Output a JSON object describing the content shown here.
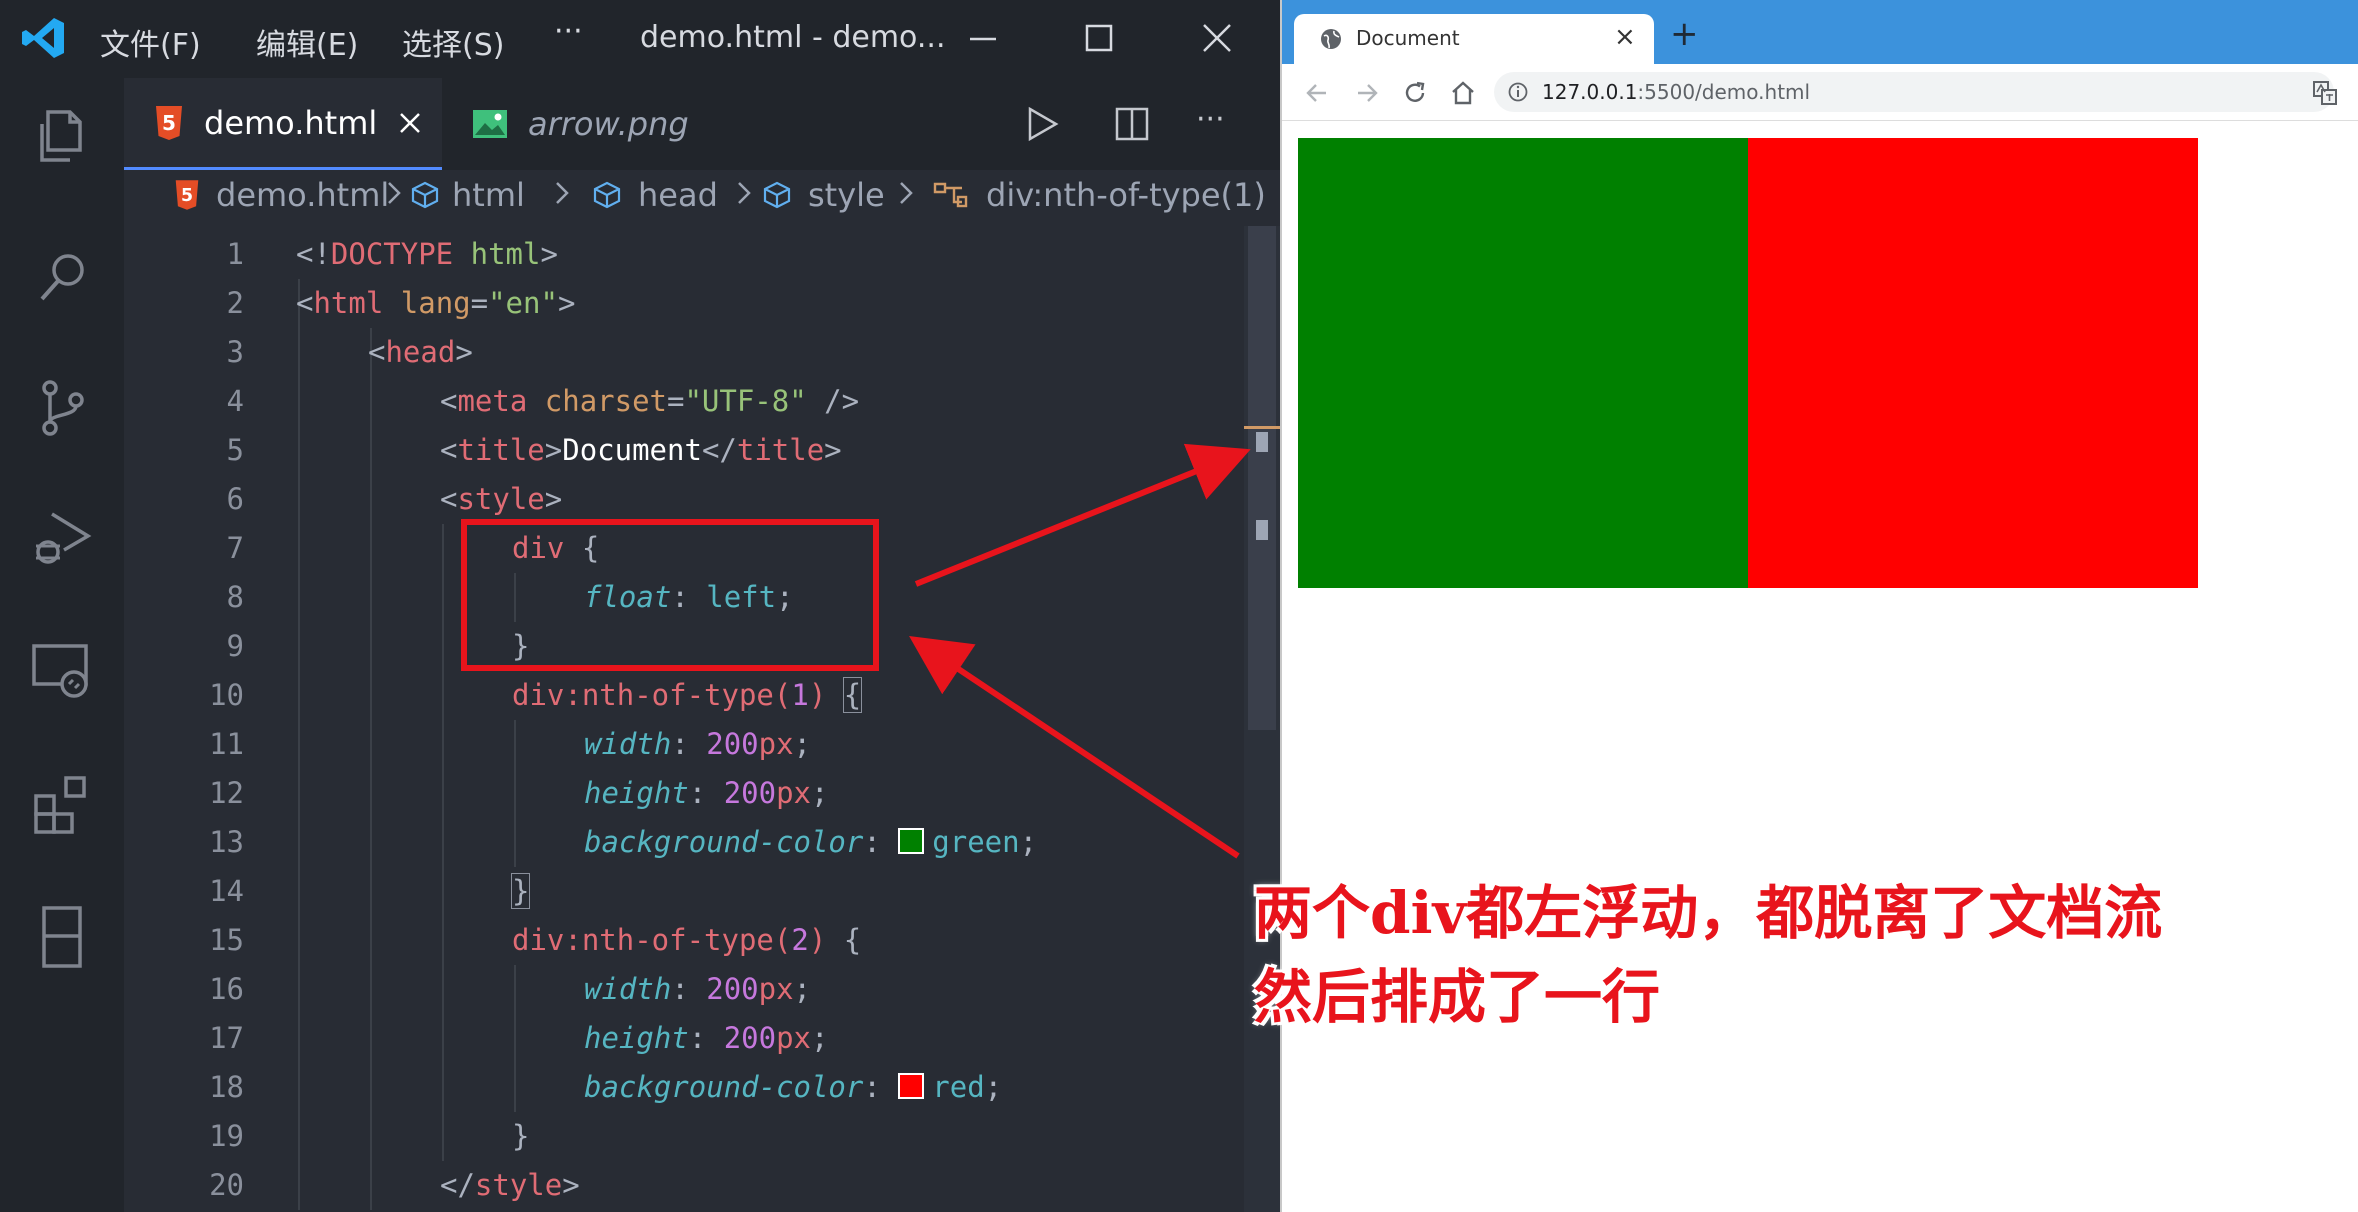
{
  "colors": {
    "editor_bg": "#282c34",
    "annotation_red": "#e8141c",
    "browser_accent": "#3c92dc",
    "box1": "#008000",
    "box2": "#ff0000"
  },
  "vscode": {
    "menu": [
      "文件(F)",
      "编辑(E)",
      "选择(S)"
    ],
    "more": "···",
    "window_title": "demo.html - demo...",
    "activity_icons": [
      "explorer-icon",
      "search-icon",
      "source-control-icon",
      "run-debug-icon",
      "remote-explorer-icon",
      "extensions-icon",
      "bookmark-icon"
    ],
    "tabs": [
      {
        "label": "demo.html",
        "icon": "html5-icon",
        "active": true
      },
      {
        "label": "arrow.png",
        "icon": "image-icon",
        "active": false
      }
    ],
    "breadcrumb": [
      "demo.html",
      "html",
      "head",
      "style",
      "div:nth-of-type(1)"
    ],
    "line_numbers": [
      "1",
      "2",
      "3",
      "4",
      "5",
      "6",
      "7",
      "8",
      "9",
      "10",
      "11",
      "12",
      "13",
      "14",
      "15",
      "16",
      "17",
      "18",
      "19",
      "20"
    ],
    "code": {
      "l1": {
        "lt": "<!",
        "tag": "DOCTYPE",
        "sp": " ",
        "attr": "html",
        "gt": ">"
      },
      "l2": {
        "lt": "<",
        "tag": "html",
        "sp": " ",
        "attr": "lang",
        "eq": "=",
        "str": "\"en\"",
        "gt": ">"
      },
      "l3": {
        "lt": "<",
        "tag": "head",
        "gt": ">"
      },
      "l4": {
        "lt": "<",
        "tag": "meta",
        "sp": " ",
        "attr": "charset",
        "eq": "=",
        "str": "\"UTF-8\"",
        "end": " />"
      },
      "l5": {
        "lt": "<",
        "tag": "title",
        "gt": ">",
        "text": "Document",
        "lt2": "</",
        "tag2": "title",
        "gt2": ">"
      },
      "l6": {
        "lt": "<",
        "tag": "style",
        "gt": ">"
      },
      "l7": {
        "sel": "div",
        "brace": " {"
      },
      "l8": {
        "prop": "float",
        "colon": ": ",
        "val": "left",
        "semi": ";"
      },
      "l9": {
        "brace": "}"
      },
      "l10": {
        "sel": "div:nth-of-type(",
        "num": "1",
        "sel2": ") ",
        "brace": "{"
      },
      "l11": {
        "prop": "width",
        "colon": ": ",
        "num": "200",
        "unit": "px",
        "semi": ";"
      },
      "l12": {
        "prop": "height",
        "colon": ": ",
        "num": "200",
        "unit": "px",
        "semi": ";"
      },
      "l13": {
        "prop": "background-color",
        "colon": ": ",
        "val": "green",
        "semi": ";"
      },
      "l14": {
        "brace": "}"
      },
      "l15": {
        "sel": "div:nth-of-type(",
        "num": "2",
        "sel2": ") ",
        "brace": "{"
      },
      "l16": {
        "prop": "width",
        "colon": ": ",
        "num": "200",
        "unit": "px",
        "semi": ";"
      },
      "l17": {
        "prop": "height",
        "colon": ": ",
        "num": "200",
        "unit": "px",
        "semi": ";"
      },
      "l18": {
        "prop": "background-color",
        "colon": ": ",
        "val": "red",
        "semi": ";"
      },
      "l19": {
        "brace": "}"
      },
      "l20": {
        "lt": "</",
        "tag": "style",
        "gt": ">"
      }
    }
  },
  "browser": {
    "tab_title": "Document",
    "url_host": "127.0.0.1",
    "url_path": ":5500/demo.html",
    "new_tab": "+",
    "close": "×"
  },
  "annotation": {
    "line1": "两个div都左浮动，都脱离了文档流",
    "line2": "然后排成了一行"
  }
}
